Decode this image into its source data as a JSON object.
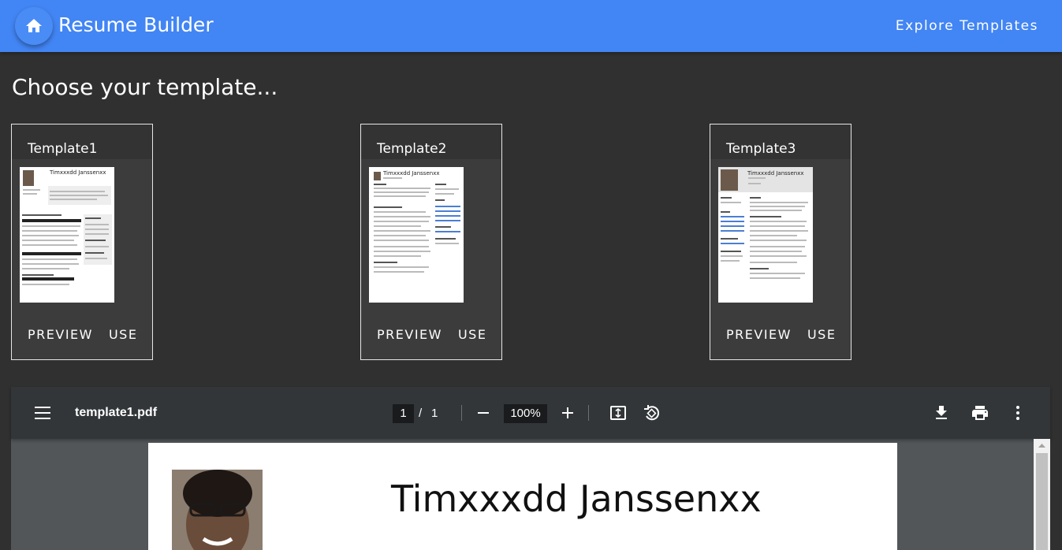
{
  "appbar": {
    "title": "Resume Builder",
    "explore_label": "Explore Templates",
    "home_icon": "home-icon",
    "color": "#4285f4"
  },
  "heading": "Choose your template...",
  "templates": [
    {
      "title": "Template1",
      "preview_label": "PREVIEW",
      "use_label": "USE",
      "thumb_name": "Timxxxdd Janssenxx"
    },
    {
      "title": "Template2",
      "preview_label": "PREVIEW",
      "use_label": "USE",
      "thumb_name": "Timxxxdd Janssenxx"
    },
    {
      "title": "Template3",
      "preview_label": "PREVIEW",
      "use_label": "USE",
      "thumb_name": "Timxxxdd Janssenxx"
    }
  ],
  "viewer": {
    "filename": "template1.pdf",
    "page_current": "1",
    "page_separator": "/",
    "page_total": "1",
    "zoom": "100%",
    "icons": [
      "menu-icon",
      "zoom-out-icon",
      "zoom-in-icon",
      "fit-page-icon",
      "rotate-icon",
      "download-icon",
      "print-icon",
      "more-vert-icon"
    ]
  },
  "document": {
    "name": "Timxxxdd Janssenxx"
  }
}
